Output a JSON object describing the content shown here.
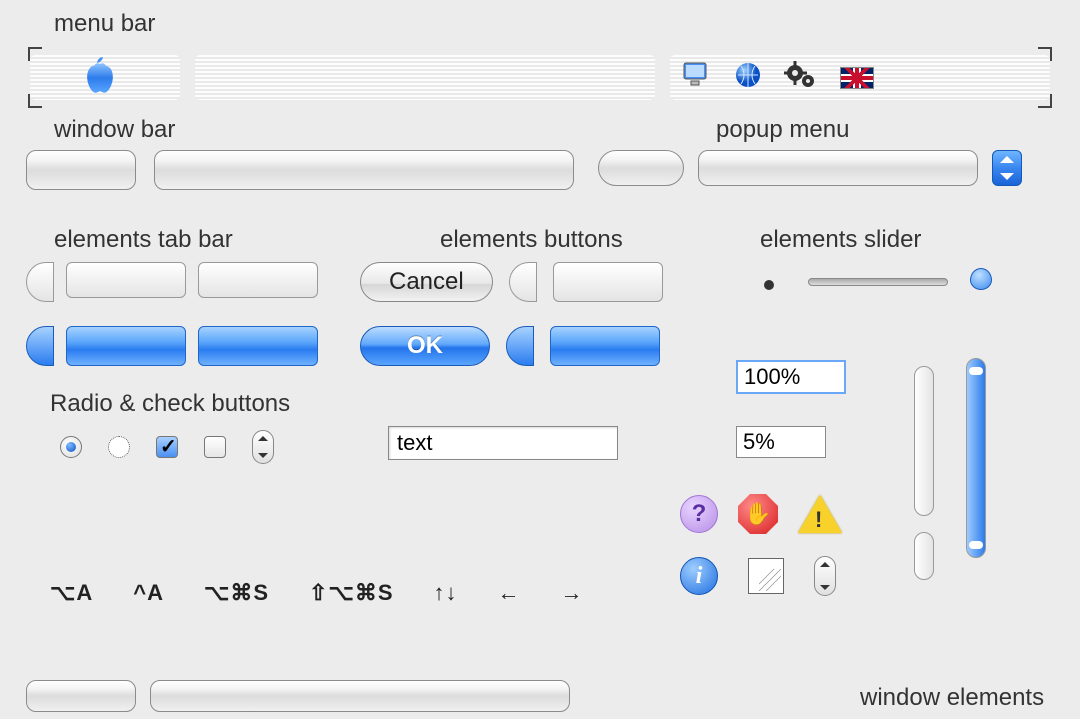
{
  "labels": {
    "menu_bar": "menu bar",
    "window_bar": "window bar",
    "popup_menu": "popup menu",
    "elements_tab": "elements tab bar",
    "elements_buttons": "elements buttons",
    "elements_slider": "elements slider",
    "radio_check": "Radio & check buttons",
    "window_elements": "window elements"
  },
  "buttons": {
    "cancel": "Cancel",
    "ok": "OK"
  },
  "fields": {
    "text_value": "text",
    "pct_100": "100%",
    "pct_5": "5%"
  },
  "menubar_icons": [
    "monitor-icon",
    "globe-icon",
    "gears-icon",
    "uk-flag-icon"
  ],
  "shortcuts": [
    "⌥A",
    "^A",
    "⌥⌘S",
    "⇧⌥⌘S",
    "↑↓",
    "←",
    "→"
  ],
  "alert_icons": [
    "help",
    "stop",
    "warning",
    "info",
    "image-well",
    "stepper"
  ],
  "colors": {
    "aqua_blue": "#2d7ceb",
    "accent": "#3a86f0"
  }
}
